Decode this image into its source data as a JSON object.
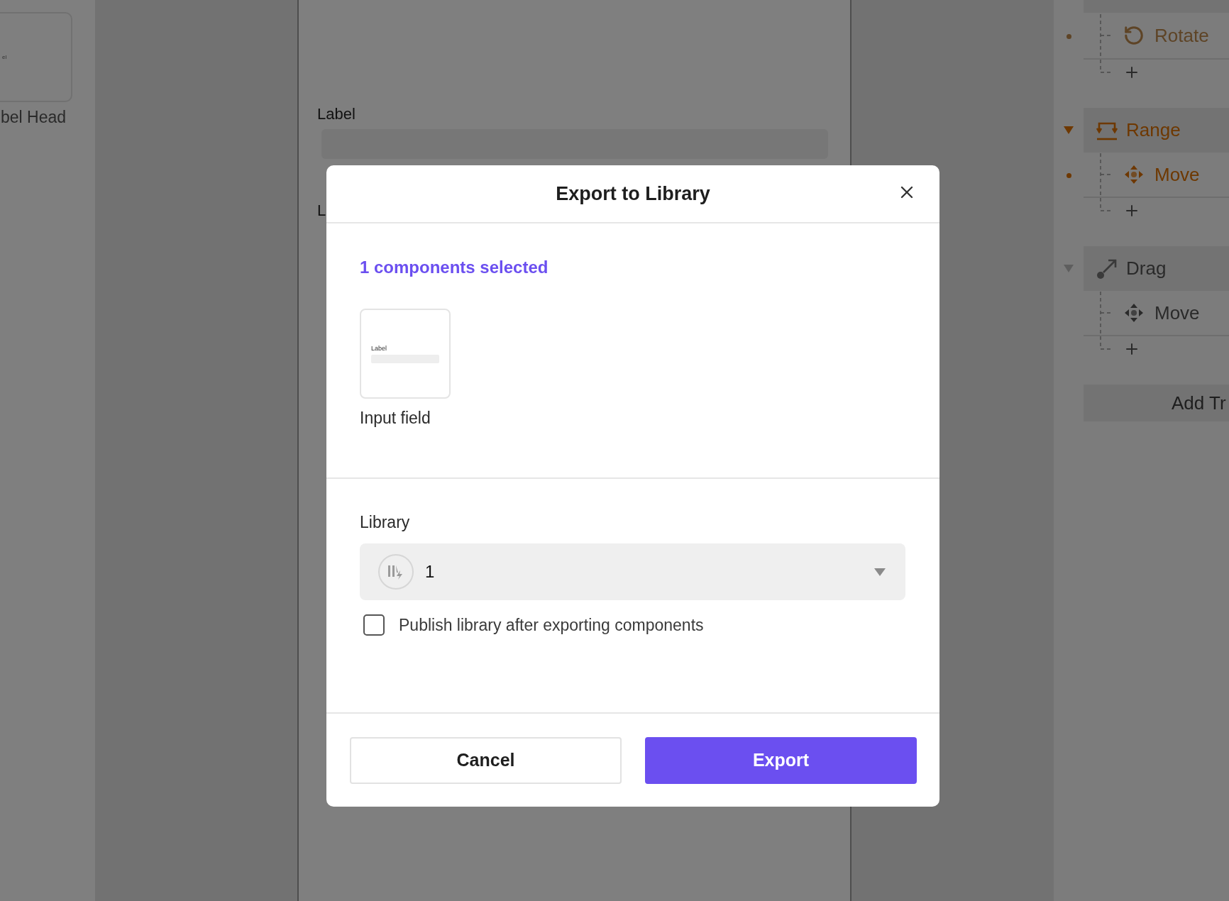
{
  "left_panel": {
    "card_text": "el",
    "caption": "bel Head"
  },
  "frame": {
    "labels": [
      "Label",
      "L"
    ]
  },
  "trigger_panel": {
    "groups": [
      {
        "actions": [
          {
            "label": "Rotate",
            "kind": "rotate",
            "active": true,
            "disabled": true
          }
        ]
      },
      {
        "label": "Range",
        "kind": "range",
        "active": true,
        "expanded": true,
        "actions": [
          {
            "label": "Move",
            "kind": "move",
            "active": true,
            "disabled": false
          }
        ]
      },
      {
        "label": "Drag",
        "kind": "drag",
        "active": false,
        "expanded": true,
        "actions": [
          {
            "label": "Move",
            "kind": "move",
            "active": false,
            "disabled": false
          }
        ]
      }
    ],
    "add_button": "Add Tr"
  },
  "dialog": {
    "title": "Export to Library",
    "selection_note": "1 components selected",
    "components": [
      {
        "name": "Input field",
        "preview_label": "Label"
      }
    ],
    "library": {
      "label": "Library",
      "value": "1"
    },
    "publish": {
      "label": "Publish library after exporting components",
      "checked": false
    },
    "buttons": [
      {
        "label": "Cancel",
        "kind": "secondary"
      },
      {
        "label": "Export",
        "kind": "primary"
      }
    ]
  }
}
